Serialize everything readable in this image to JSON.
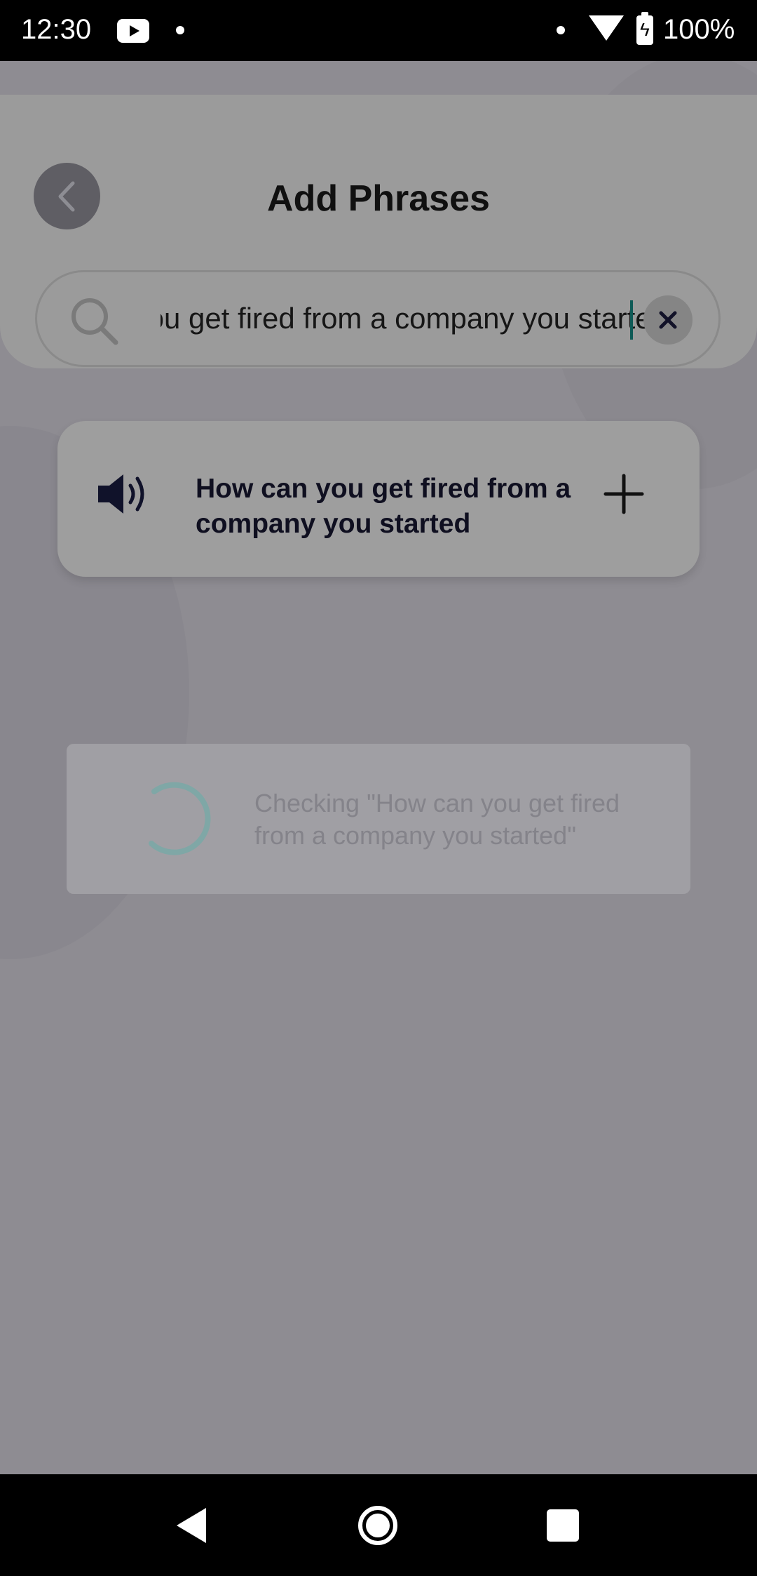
{
  "status_bar": {
    "time": "12:30",
    "battery": "100%"
  },
  "header": {
    "title": "Add Phrases",
    "back_icon": "chevron-left-icon"
  },
  "search": {
    "value": "How can you get fired from a company you started",
    "search_icon": "search-icon",
    "clear_icon": "close-icon"
  },
  "result": {
    "phrase": "How can you get fired from a company you started",
    "speaker_icon": "speaker-icon",
    "add_icon": "plus-icon"
  },
  "loading": {
    "message": "Checking \"How can you get fired from a company you started\""
  },
  "colors": {
    "accent": "#0e5a56",
    "spinner": "#7fa7a6"
  }
}
